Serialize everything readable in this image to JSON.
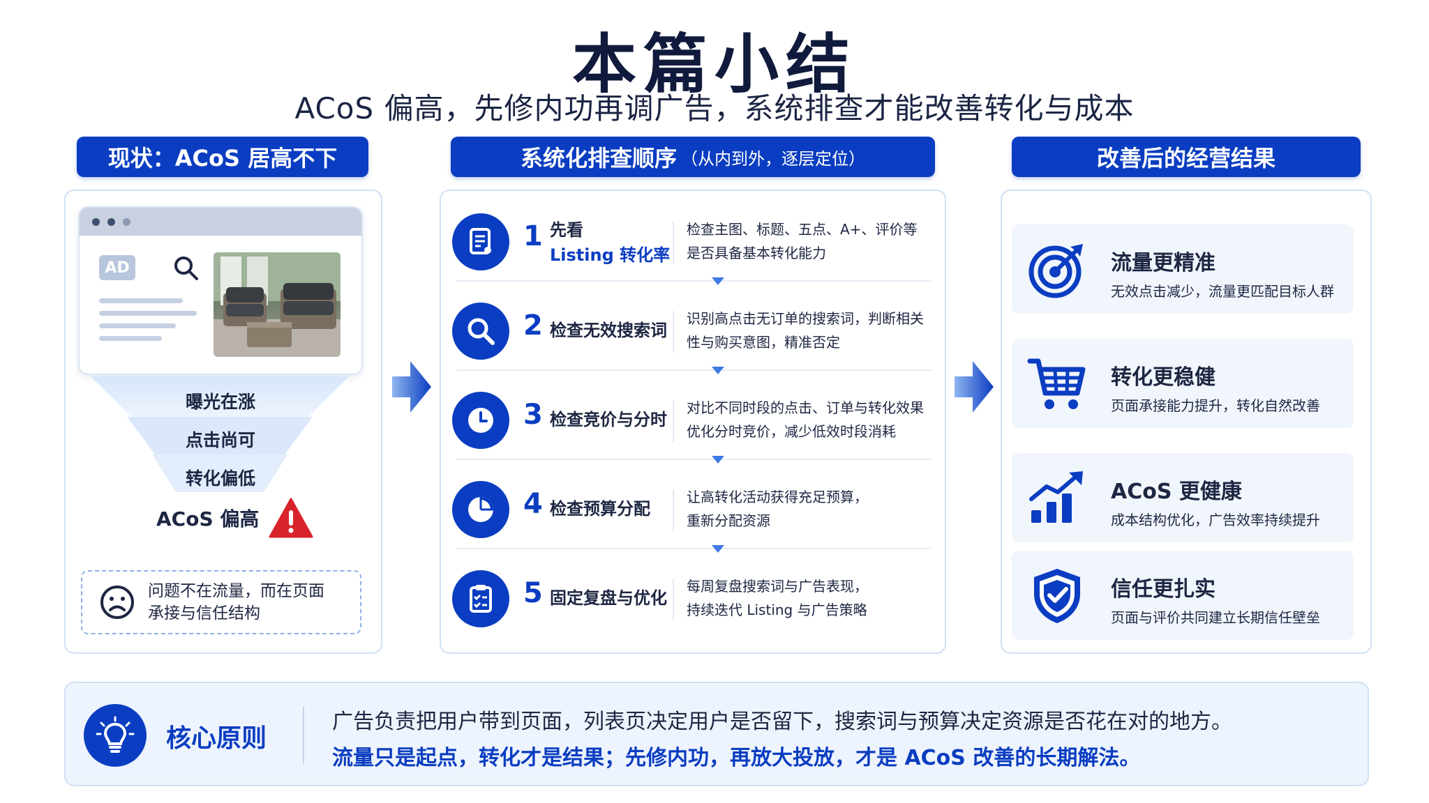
{
  "header": {
    "title": "本篇小结",
    "subtitle": "ACoS 偏高，先修内功再调广告，系统排查才能改善转化与成本"
  },
  "left": {
    "header": "现状：ACoS 居高不下",
    "ad_badge": "AD",
    "funnel": [
      "曝光在涨",
      "点击尚可",
      "转化偏低"
    ],
    "warning_label": "ACoS 偏高",
    "problem_line1": "问题不在流量，而在页面",
    "problem_line2": "承接与信任结构"
  },
  "middle": {
    "header": "系统化排查顺序",
    "header_hint": "（从内到外，逐层定位）",
    "steps": [
      {
        "num": "1",
        "title": "先看",
        "title_accent": "Listing 转化率",
        "desc1": "检查主图、标题、五点、A+、评价等",
        "desc2": "是否具备基本转化能力"
      },
      {
        "num": "2",
        "title": "检查无效搜索词",
        "desc1": "识别高点击无订单的搜索词，判断相关",
        "desc2": "性与购买意图，精准否定"
      },
      {
        "num": "3",
        "title": "检查竞价与分时",
        "desc1": "对比不同时段的点击、订单与转化效果",
        "desc2": "优化分时竞价，减少低效时段消耗"
      },
      {
        "num": "4",
        "title": "检查预算分配",
        "desc1": "让高转化活动获得充足预算，",
        "desc2": "重新分配资源"
      },
      {
        "num": "5",
        "title": "固定复盘与优化",
        "desc1": "每周复盘搜索词与广告表现，",
        "desc2": "持续迭代 Listing 与广告策略"
      }
    ]
  },
  "right": {
    "header": "改善后的经营结果",
    "results": [
      {
        "title": "流量更精准",
        "desc": "无效点击减少，流量更匹配目标人群"
      },
      {
        "title": "转化更稳健",
        "desc": "页面承接能力提升，转化自然改善"
      },
      {
        "title": "ACoS 更健康",
        "desc": "成本结构优化，广告效率持续提升"
      },
      {
        "title": "信任更扎实",
        "desc": "页面与评价共同建立长期信任壁垒"
      }
    ]
  },
  "core": {
    "label": "核心原则",
    "line1": "广告负责把用户带到页面，列表页决定用户是否留下，搜索词与预算决定资源是否花在对的地方。",
    "line2": "流量只是起点，转化才是结果；先修内功，再放大投放，才是 ACoS 改善的长期解法。"
  },
  "colors": {
    "primary": "#0a3dc1",
    "accent": "#3f79e3",
    "warning": "#d8232a"
  },
  "icons": [
    "document-icon",
    "search-icon",
    "clock-icon",
    "pie-chart-icon",
    "clipboard-check-icon",
    "target-icon",
    "cart-icon",
    "growth-chart-icon",
    "shield-check-icon",
    "lightbulb-icon",
    "sad-face-icon",
    "warning-icon"
  ]
}
